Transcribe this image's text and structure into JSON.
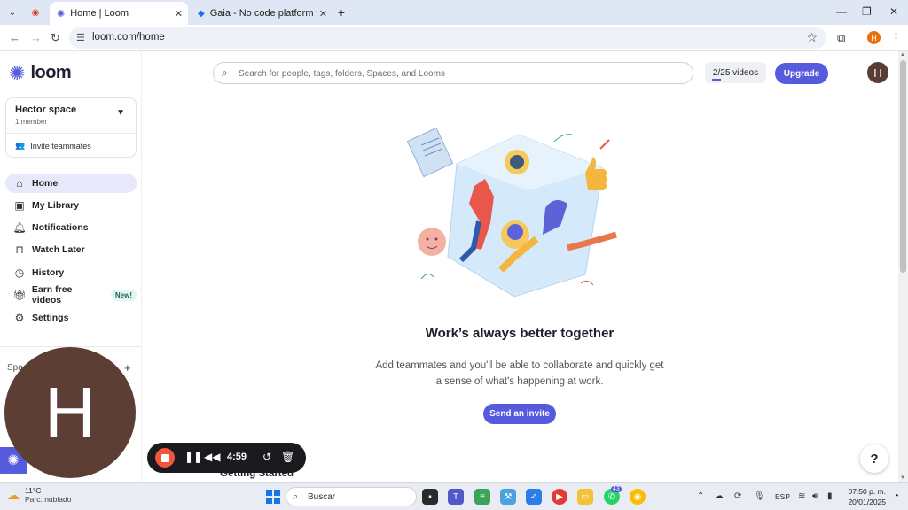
{
  "browser": {
    "tabs": [
      {
        "title": "Home | Loom",
        "active": true
      },
      {
        "title": "Gaia - No code platform to bui",
        "active": false
      }
    ],
    "url": "loom.com/home",
    "profile_initial": "H"
  },
  "sidebar": {
    "brand": "loom",
    "workspace": {
      "name": "Hector space",
      "members": "1 member",
      "invite_label": "Invite teammates"
    },
    "nav": [
      {
        "label": "Home",
        "icon": "home-icon",
        "active": true
      },
      {
        "label": "My Library",
        "icon": "library-icon",
        "active": false
      },
      {
        "label": "Notifications",
        "icon": "bell-icon",
        "active": false
      },
      {
        "label": "Watch Later",
        "icon": "bookmark-icon",
        "active": false
      },
      {
        "label": "History",
        "icon": "clock-icon",
        "active": false
      },
      {
        "label": "Earn free videos",
        "icon": "gift-icon",
        "active": false,
        "badge": "New!"
      },
      {
        "label": "Settings",
        "icon": "gear-icon",
        "active": false
      }
    ],
    "spaces_label": "Spa"
  },
  "header": {
    "search_placeholder": "Search for people, tags, folders, Spaces, and Looms",
    "usage": "2/25 videos",
    "upgrade_label": "Upgrade",
    "avatar_initial": "H"
  },
  "main": {
    "headline": "Work’s always better together",
    "subtext": "Add teammates and you'll be able to collaborate and quickly get a sense of what's happening at work.",
    "invite_button": "Send an invite",
    "section_title": "Getting Started"
  },
  "recording": {
    "camera_initial": "H",
    "time": "4:59"
  },
  "taskbar": {
    "temperature": "11°C",
    "condition": "Parc. nublado",
    "search_label": "Buscar",
    "language": "ESP",
    "time": "07:50 p. m.",
    "date": "20/01/2025",
    "teams_badge": "43"
  },
  "colors": {
    "brand": "#565ADD",
    "record": "#f1563a"
  }
}
